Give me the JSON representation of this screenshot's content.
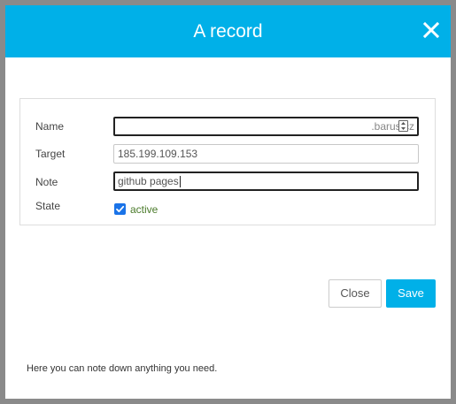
{
  "dialog": {
    "title": "A record",
    "close_icon": "close-icon"
  },
  "form": {
    "name": {
      "label": "Name",
      "value": "",
      "suffix": ".barus.cz"
    },
    "target": {
      "label": "Target",
      "value": "185.199.109.153"
    },
    "note": {
      "label": "Note",
      "value": "github pages"
    },
    "state": {
      "label": "State",
      "checkbox_label": "active",
      "checked": true
    }
  },
  "buttons": {
    "close_label": "Close",
    "save_label": "Save"
  },
  "footer": {
    "note": "Here you can note down anything you need."
  },
  "colors": {
    "accent": "#00b0e8",
    "checkbox": "#1a73e8",
    "check_label": "#4a7a2a"
  }
}
